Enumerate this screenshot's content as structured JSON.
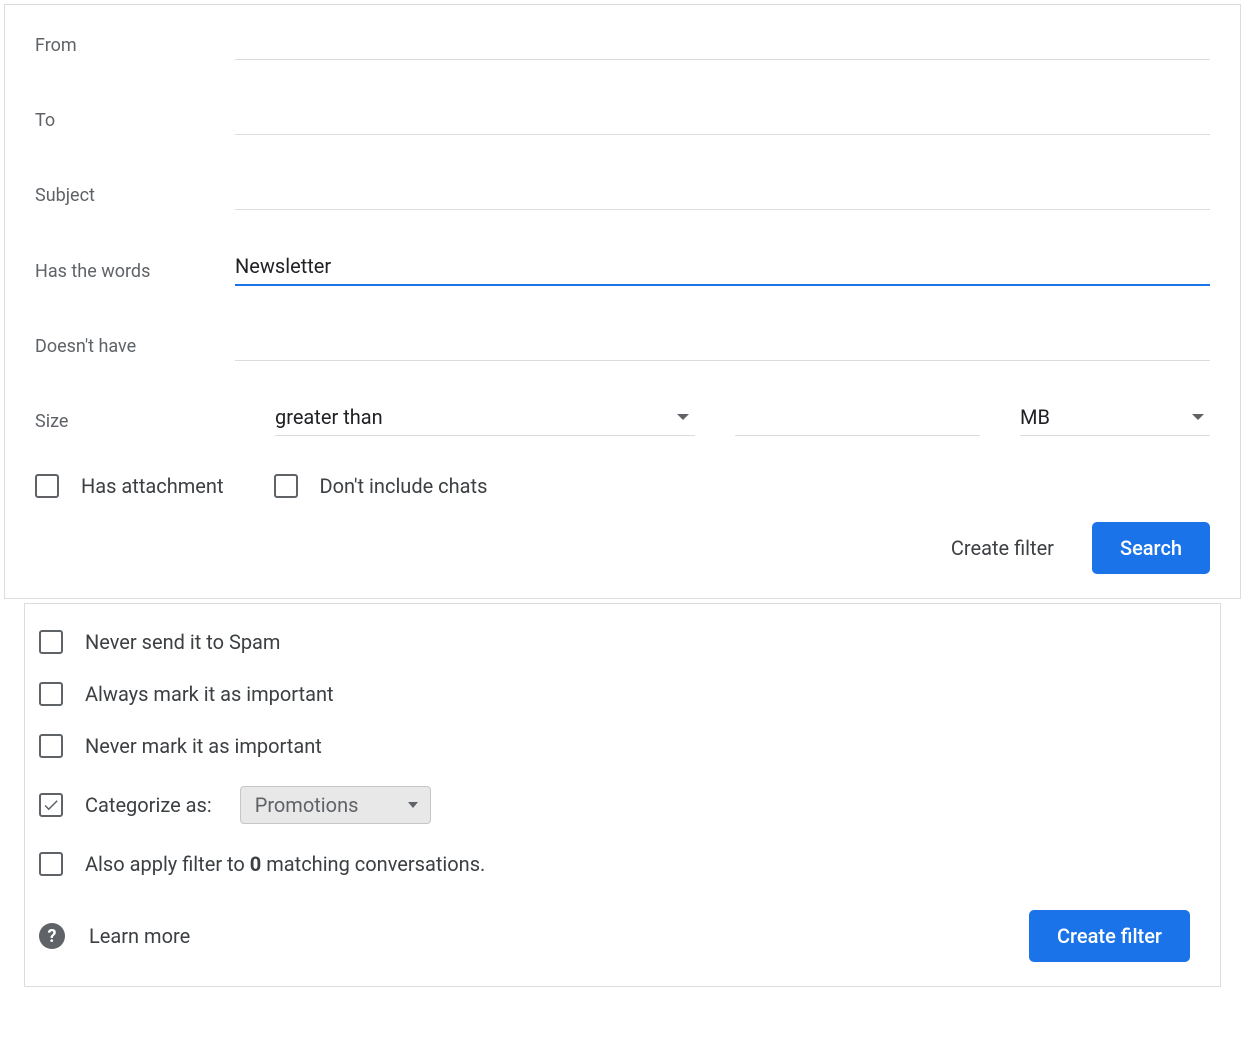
{
  "criteria": {
    "labels": {
      "from": "From",
      "to": "To",
      "subject": "Subject",
      "has_words": "Has the words",
      "doesnt_have": "Doesn't have",
      "size": "Size"
    },
    "values": {
      "from": "",
      "to": "",
      "subject": "",
      "has_words": "Newsletter",
      "doesnt_have": "",
      "size_comparator": "greater than",
      "size_value": "",
      "size_unit": "MB"
    },
    "checkboxes": {
      "has_attachment_label": "Has attachment",
      "has_attachment_checked": false,
      "dont_include_chats_label": "Don't include chats",
      "dont_include_chats_checked": false
    },
    "buttons": {
      "create_filter": "Create filter",
      "search": "Search"
    }
  },
  "actions": {
    "items": [
      {
        "label": "Never send it to Spam",
        "checked": false
      },
      {
        "label": "Always mark it as important",
        "checked": false
      },
      {
        "label": "Never mark it as important",
        "checked": false
      }
    ],
    "categorize": {
      "label_prefix": "Categorize as:",
      "selected": "Promotions",
      "checked": true
    },
    "also_apply": {
      "prefix": "Also apply filter to",
      "count": "0",
      "suffix": "matching conversations.",
      "checked": false
    },
    "footer": {
      "learn_more": "Learn more",
      "create_filter": "Create filter"
    }
  },
  "colors": {
    "primary": "#1a73e8",
    "border": "#dadce0",
    "muted_text": "#5f6368"
  }
}
